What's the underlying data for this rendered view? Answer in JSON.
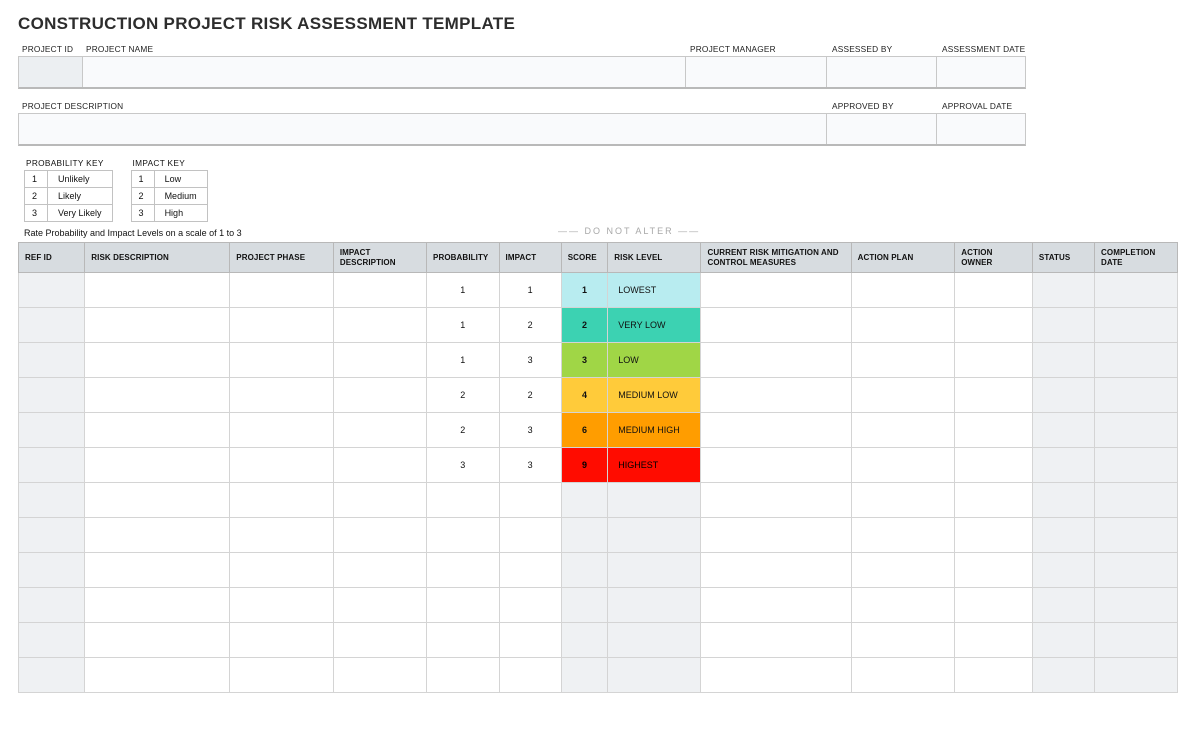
{
  "title": "CONSTRUCTION PROJECT RISK ASSESSMENT TEMPLATE",
  "info_labels_row1": {
    "project_id": "PROJECT ID",
    "project_name": "PROJECT NAME",
    "project_manager": "PROJECT MANAGER",
    "assessed_by": "ASSESSED BY",
    "assessment_date": "ASSESSMENT DATE"
  },
  "info_labels_row2": {
    "project_description": "PROJECT DESCRIPTION",
    "approved_by": "APPROVED BY",
    "approval_date": "APPROVAL DATE"
  },
  "keys": {
    "probability_title": "PROBABILITY KEY",
    "impact_title": "IMPACT KEY",
    "probability": [
      {
        "n": "1",
        "label": "Unlikely"
      },
      {
        "n": "2",
        "label": "Likely"
      },
      {
        "n": "3",
        "label": "Very Likely"
      }
    ],
    "impact": [
      {
        "n": "1",
        "label": "Low"
      },
      {
        "n": "2",
        "label": "Medium"
      },
      {
        "n": "3",
        "label": "High"
      }
    ]
  },
  "rate_note": "Rate Probability and Impact Levels on a scale of 1 to 3",
  "do_not_alter": "—— DO NOT ALTER ——",
  "columns": {
    "ref_id": "REF ID",
    "risk_description": "RISK DESCRIPTION",
    "project_phase": "PROJECT PHASE",
    "impact_description": "IMPACT DESCRIPTION",
    "probability": "PROBABILITY",
    "impact": "IMPACT",
    "score": "SCORE",
    "risk_level": "RISK LEVEL",
    "current_mitigation": "CURRENT RISK MITIGATION AND CONTROL MEASURES",
    "action_plan": "ACTION PLAN",
    "action_owner": "ACTION OWNER",
    "status": "STATUS",
    "completion_date": "COMPLETION DATE"
  },
  "rows": [
    {
      "probability": "1",
      "impact": "1",
      "score": "1",
      "risk_level": "LOWEST",
      "cls": "c-lowest"
    },
    {
      "probability": "1",
      "impact": "2",
      "score": "2",
      "risk_level": "VERY LOW",
      "cls": "c-verylow"
    },
    {
      "probability": "1",
      "impact": "3",
      "score": "3",
      "risk_level": "LOW",
      "cls": "c-low"
    },
    {
      "probability": "2",
      "impact": "2",
      "score": "4",
      "risk_level": "MEDIUM LOW",
      "cls": "c-medlow"
    },
    {
      "probability": "2",
      "impact": "3",
      "score": "6",
      "risk_level": "MEDIUM HIGH",
      "cls": "c-medhigh"
    },
    {
      "probability": "3",
      "impact": "3",
      "score": "9",
      "risk_level": "HIGHEST",
      "cls": "c-highest"
    },
    {
      "probability": "",
      "impact": "",
      "score": "",
      "risk_level": "",
      "cls": ""
    },
    {
      "probability": "",
      "impact": "",
      "score": "",
      "risk_level": "",
      "cls": ""
    },
    {
      "probability": "",
      "impact": "",
      "score": "",
      "risk_level": "",
      "cls": ""
    },
    {
      "probability": "",
      "impact": "",
      "score": "",
      "risk_level": "",
      "cls": ""
    },
    {
      "probability": "",
      "impact": "",
      "score": "",
      "risk_level": "",
      "cls": ""
    },
    {
      "probability": "",
      "impact": "",
      "score": "",
      "risk_level": "",
      "cls": ""
    }
  ]
}
